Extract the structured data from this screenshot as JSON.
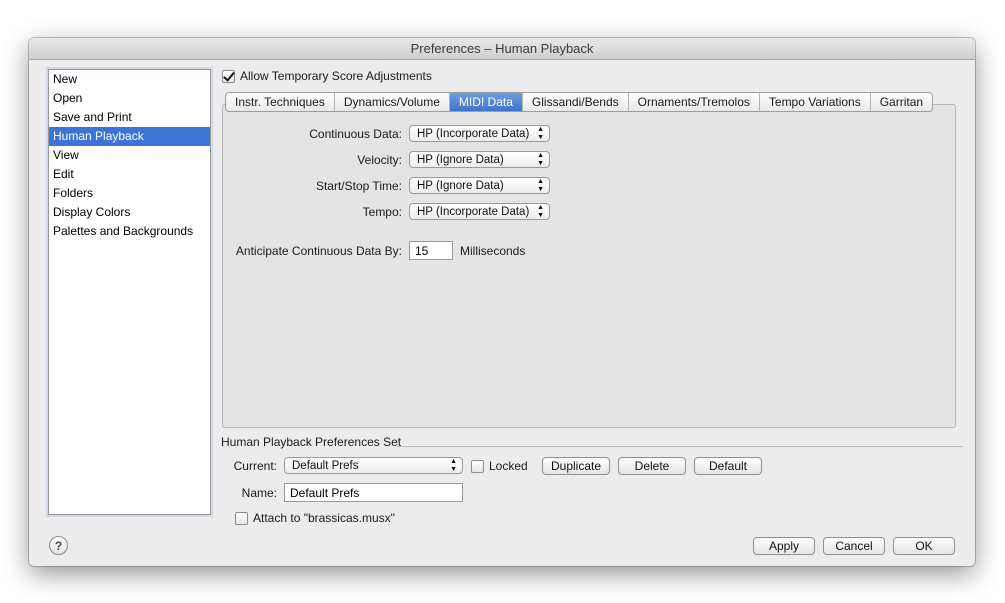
{
  "window": {
    "title": "Preferences – Human Playback"
  },
  "sidebar": {
    "items": [
      {
        "label": "New"
      },
      {
        "label": "Open"
      },
      {
        "label": "Save and Print"
      },
      {
        "label": "Human Playback",
        "selected": true
      },
      {
        "label": "View"
      },
      {
        "label": "Edit"
      },
      {
        "label": "Folders"
      },
      {
        "label": "Display Colors"
      },
      {
        "label": "Palettes and Backgrounds"
      }
    ]
  },
  "allow_temp": {
    "label": "Allow Temporary Score Adjustments",
    "checked": true
  },
  "tabs": [
    {
      "label": "Instr. Techniques"
    },
    {
      "label": "Dynamics/Volume"
    },
    {
      "label": "MIDI Data",
      "active": true
    },
    {
      "label": "Glissandi/Bends"
    },
    {
      "label": "Ornaments/Tremolos"
    },
    {
      "label": "Tempo Variations"
    },
    {
      "label": "Garritan"
    }
  ],
  "midi": {
    "continuous": {
      "label": "Continuous Data:",
      "value": "HP (Incorporate Data)"
    },
    "velocity": {
      "label": "Velocity:",
      "value": "HP (Ignore Data)"
    },
    "startstop": {
      "label": "Start/Stop Time:",
      "value": "HP (Ignore Data)"
    },
    "tempo": {
      "label": "Tempo:",
      "value": "HP (Incorporate Data)"
    },
    "anticipate": {
      "label": "Anticipate Continuous Data By:",
      "value": "15",
      "unit": "Milliseconds"
    }
  },
  "prefs_set": {
    "title": "Human Playback Preferences Set",
    "current_label": "Current:",
    "current_value": "Default Prefs",
    "locked_label": "Locked",
    "duplicate_label": "Duplicate",
    "delete_label": "Delete",
    "default_label": "Default",
    "name_label": "Name:",
    "name_value": "Default Prefs",
    "attach_label": "Attach to \"brassicas.musx\""
  },
  "footer": {
    "help_symbol": "?",
    "apply_label": "Apply",
    "cancel_label": "Cancel",
    "ok_label": "OK"
  },
  "colors": {
    "selection": "#3b73d6",
    "window_bg": "#ececec"
  }
}
